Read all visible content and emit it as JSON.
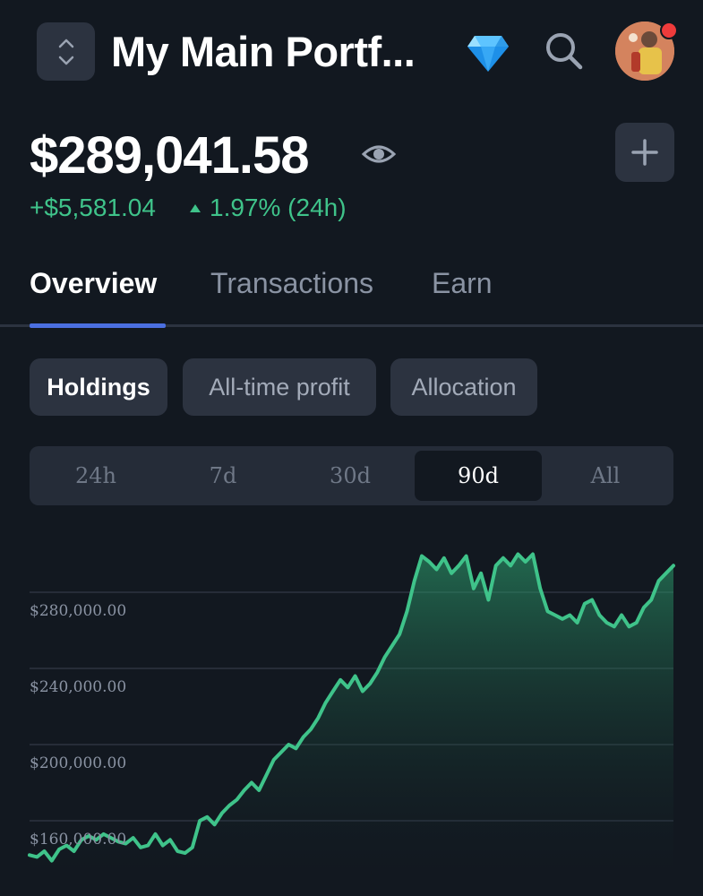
{
  "header": {
    "title": "My Main Portf...",
    "icons": [
      "switch-portfolio-icon",
      "diamond-icon",
      "search-icon",
      "avatar"
    ]
  },
  "balance": {
    "value": "$289,041.58",
    "change_abs": "+$5,581.04",
    "change_pct": "1.97% (24h)",
    "positive_color": "#3fc38a"
  },
  "tabs": [
    {
      "label": "Overview",
      "active": true
    },
    {
      "label": "Transactions",
      "active": false
    },
    {
      "label": "Earn",
      "active": false
    }
  ],
  "chips": [
    {
      "label": "Holdings",
      "active": true
    },
    {
      "label": "All-time profit",
      "active": false
    },
    {
      "label": "Allocation",
      "active": false
    }
  ],
  "ranges": [
    {
      "label": "24h",
      "active": false
    },
    {
      "label": "7d",
      "active": false
    },
    {
      "label": "30d",
      "active": false
    },
    {
      "label": "90d",
      "active": true
    },
    {
      "label": "All",
      "active": false
    }
  ],
  "chart_data": {
    "type": "area",
    "color": "#3fc38a",
    "y_ticks": [
      "$280,000.00",
      "$240,000.00",
      "$200,000.00",
      "$160,000.00"
    ],
    "y_tick_values": [
      280000,
      240000,
      200000,
      160000
    ],
    "ylim": [
      140000,
      310000
    ],
    "values": [
      142000,
      141000,
      144000,
      139000,
      145000,
      147000,
      144000,
      150000,
      152000,
      150000,
      153000,
      151000,
      149000,
      148000,
      151000,
      146000,
      147000,
      153000,
      147000,
      150000,
      144000,
      143000,
      146000,
      160000,
      162000,
      158000,
      164000,
      168000,
      171000,
      176000,
      180000,
      176000,
      184000,
      192000,
      196000,
      200000,
      198000,
      204000,
      208000,
      214000,
      222000,
      228000,
      234000,
      230000,
      236000,
      228000,
      232000,
      238000,
      246000,
      252000,
      258000,
      270000,
      286000,
      299000,
      296000,
      292000,
      298000,
      290000,
      294000,
      299000,
      282000,
      290000,
      276000,
      294000,
      298000,
      294000,
      300000,
      296000,
      300000,
      282000,
      270000,
      268000,
      266000,
      268000,
      264000,
      274000,
      276000,
      268000,
      264000,
      262000,
      268000,
      262000,
      264000,
      272000,
      276000,
      286000,
      290000,
      294000
    ],
    "grid": true
  }
}
